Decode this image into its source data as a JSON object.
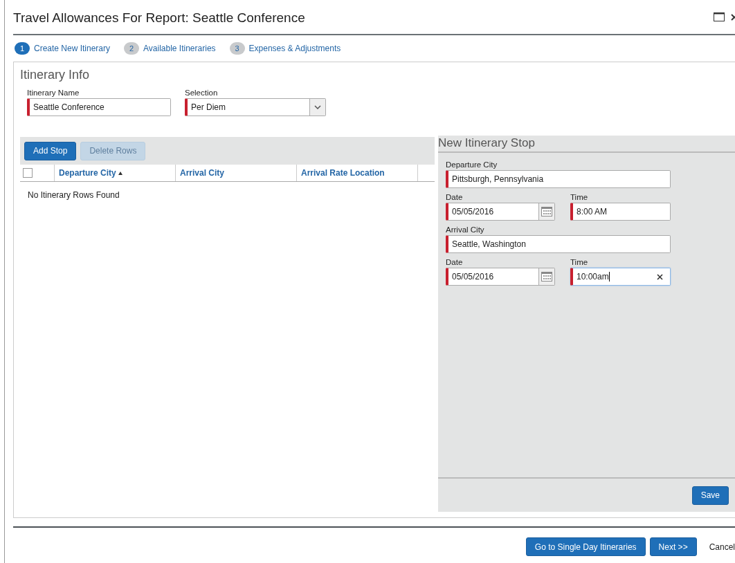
{
  "window": {
    "title": "Travel Allowances For Report: Seattle Conference"
  },
  "steps": [
    {
      "number": "1",
      "label": "Create New Itinerary",
      "selected": true
    },
    {
      "number": "2",
      "label": "Available Itineraries",
      "selected": false
    },
    {
      "number": "3",
      "label": "Expenses & Adjustments",
      "selected": false
    }
  ],
  "itinerary_info": {
    "title": "Itinerary Info",
    "fields": [
      {
        "kind": "text",
        "label": "Itinerary Name",
        "value": "Seattle Conference",
        "required": true
      },
      {
        "kind": "select",
        "label": "Selection",
        "value": "Per Diem",
        "required": true
      }
    ]
  },
  "toolbar": [
    {
      "label": "Add Stop",
      "disabled": false
    },
    {
      "label": "Delete Rows",
      "disabled": true
    }
  ],
  "table": {
    "select_all_checked": false,
    "columns": [
      {
        "label": "Departure City",
        "sorted": true
      },
      {
        "label": "Arrival City",
        "sorted": false
      },
      {
        "label": "Arrival Rate Location",
        "sorted": false
      }
    ],
    "empty_message": "No Itinerary Rows Found"
  },
  "stop_panel": {
    "title": "New Itinerary Stop",
    "rows": [
      [
        {
          "kind": "text",
          "label": "Departure City",
          "value": "Pittsburgh, Pennsylvania",
          "required": true,
          "focused": false
        }
      ],
      [
        {
          "kind": "date",
          "label": "Date",
          "value": "05/05/2016",
          "required": true,
          "focused": false
        },
        {
          "kind": "time",
          "label": "Time",
          "value": "8:00 AM",
          "required": true,
          "focused": false
        }
      ],
      [
        {
          "kind": "text",
          "label": "Arrival City",
          "value": "Seattle, Washington",
          "required": true,
          "focused": false
        }
      ],
      [
        {
          "kind": "date",
          "label": "Date",
          "value": "05/05/2016",
          "required": true,
          "focused": false
        },
        {
          "kind": "time",
          "label": "Time",
          "value": "10:00am",
          "required": true,
          "focused": true
        }
      ]
    ],
    "save": "Save"
  },
  "footer": {
    "buttons": [
      {
        "kind": "primary",
        "label": "Go to Single Day Itineraries"
      },
      {
        "kind": "primary",
        "label": "Next >>"
      },
      {
        "kind": "link",
        "label": "Cancel"
      }
    ]
  }
}
